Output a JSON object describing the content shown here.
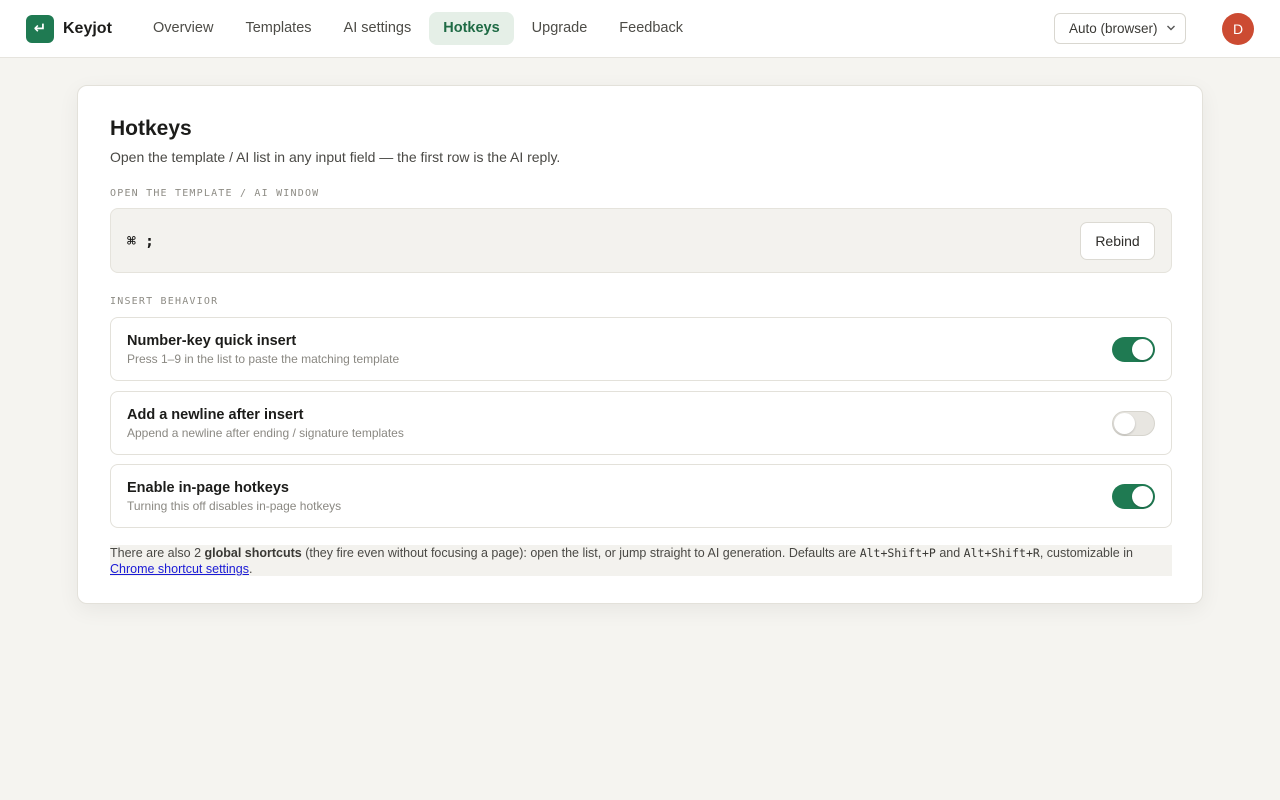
{
  "app": {
    "logo_glyph": "↵",
    "brand": "Keyjot"
  },
  "nav": {
    "items": [
      {
        "label": "Overview",
        "active": false
      },
      {
        "label": "Templates",
        "active": false
      },
      {
        "label": "AI settings",
        "active": false
      },
      {
        "label": "Hotkeys",
        "active": true
      },
      {
        "label": "Upgrade",
        "active": false
      },
      {
        "label": "Feedback",
        "active": false
      }
    ]
  },
  "language_select": {
    "value": "Auto (browser)",
    "icon": "chevron-down-icon"
  },
  "user": {
    "avatar_initial": "D",
    "avatar_color": "#cc4b32"
  },
  "page": {
    "title": "Hotkeys",
    "subtitle": "Open the template / AI list in any input field — the first row is the AI reply."
  },
  "open_window": {
    "section_label": "OPEN THE TEMPLATE / AI WINDOW",
    "key_combo": "⌘ ;",
    "rebind_label": "Rebind"
  },
  "insert_behavior": {
    "section_label": "INSERT BEHAVIOR",
    "options": [
      {
        "title": "Number-key quick insert",
        "description": "Press 1–9 in the list to paste the matching template",
        "enabled": true
      },
      {
        "title": "Add a newline after insert",
        "description": "Append a newline after ending / signature templates",
        "enabled": false
      },
      {
        "title": "Enable in-page hotkeys",
        "description": "Turning this off disables in-page hotkeys",
        "enabled": true
      }
    ]
  },
  "footnote": {
    "text_1": "There are also 2 ",
    "bold": "global shortcuts",
    "text_2": " (they fire even without focusing a page): open the list, or jump straight to AI generation. Defaults are ",
    "shortcut_1": "Alt+Shift+P",
    "text_3": " and ",
    "shortcut_2": "Alt+Shift+R",
    "text_4": ", customizable in ",
    "link": "Chrome shortcut settings",
    "text_5": "."
  },
  "colors": {
    "accent": "#1f7a52",
    "nav_active_bg": "#e5efe7",
    "page_bg": "#f5f4f0"
  }
}
